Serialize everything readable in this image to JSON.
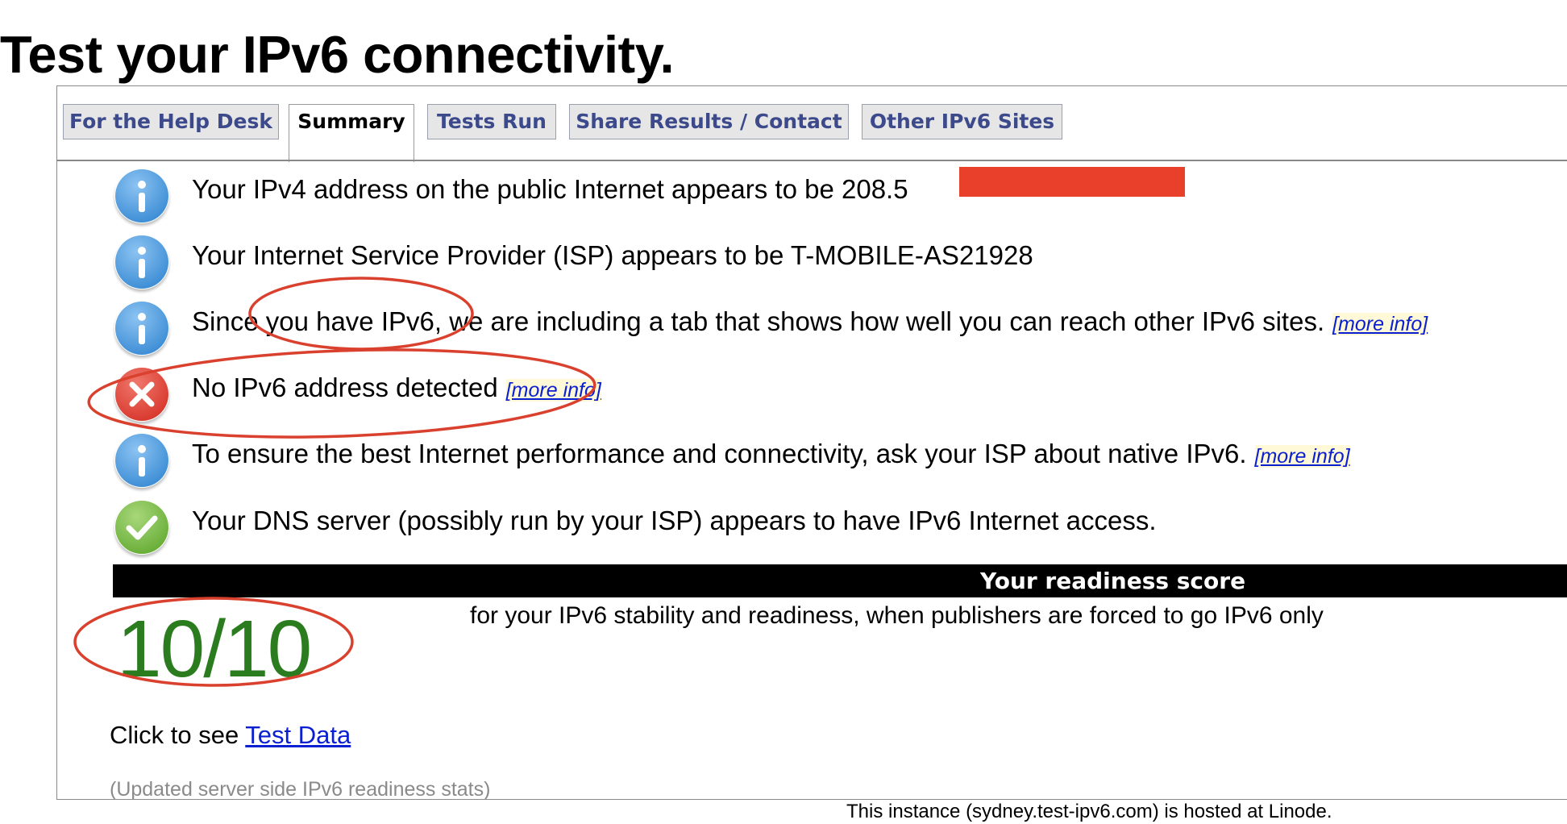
{
  "page": {
    "title": "Test your IPv6 connectivity."
  },
  "tabs": [
    {
      "label": "For the Help Desk",
      "active": false
    },
    {
      "label": "Summary",
      "active": true
    },
    {
      "label": "Tests Run",
      "active": false
    },
    {
      "label": "Share Results / Contact",
      "active": false
    },
    {
      "label": "Other IPv6 Sites",
      "active": false
    }
  ],
  "results": [
    {
      "icon": "info-icon",
      "text": "Your IPv4 address on the public Internet appears to be 208.5",
      "more_info": ""
    },
    {
      "icon": "info-icon",
      "text": "Your Internet Service Provider (ISP) appears to be T-MOBILE-AS21928",
      "more_info": ""
    },
    {
      "icon": "info-icon",
      "text": "Since you have IPv6, we are including a tab that shows how well you can reach other IPv6 sites.",
      "more_info": "[more info]"
    },
    {
      "icon": "error-icon",
      "text": "No IPv6 address detected",
      "more_info": "[more info]"
    },
    {
      "icon": "info-icon",
      "text": "To ensure the best Internet performance and connectivity, ask your ISP about native IPv6.",
      "more_info": "[more info]"
    },
    {
      "icon": "check-icon",
      "text": "Your DNS server (possibly run by your ISP) appears to have IPv6 Internet access.",
      "more_info": ""
    }
  ],
  "score": {
    "banner": "Your readiness score",
    "value": "10/10",
    "description": "for your IPv6 stability and readiness, when publishers are forced to go IPv6 only"
  },
  "click_line": {
    "prefix": "Click to see ",
    "link": "Test Data"
  },
  "updated_note": "(Updated server side IPv6 readiness stats)",
  "footer": "This instance (sydney.test-ipv6.com) is hosted at Linode.",
  "colors": {
    "tab_text": "#3c4a8c",
    "info_blue": "#3f8fd6",
    "error_red": "#d93a2f",
    "check_green": "#6aaf3a",
    "score_green": "#2b7c1f",
    "link_blue": "#0a1fd2",
    "redaction_red": "#e8402a",
    "annotation_red": "#d9412e"
  }
}
